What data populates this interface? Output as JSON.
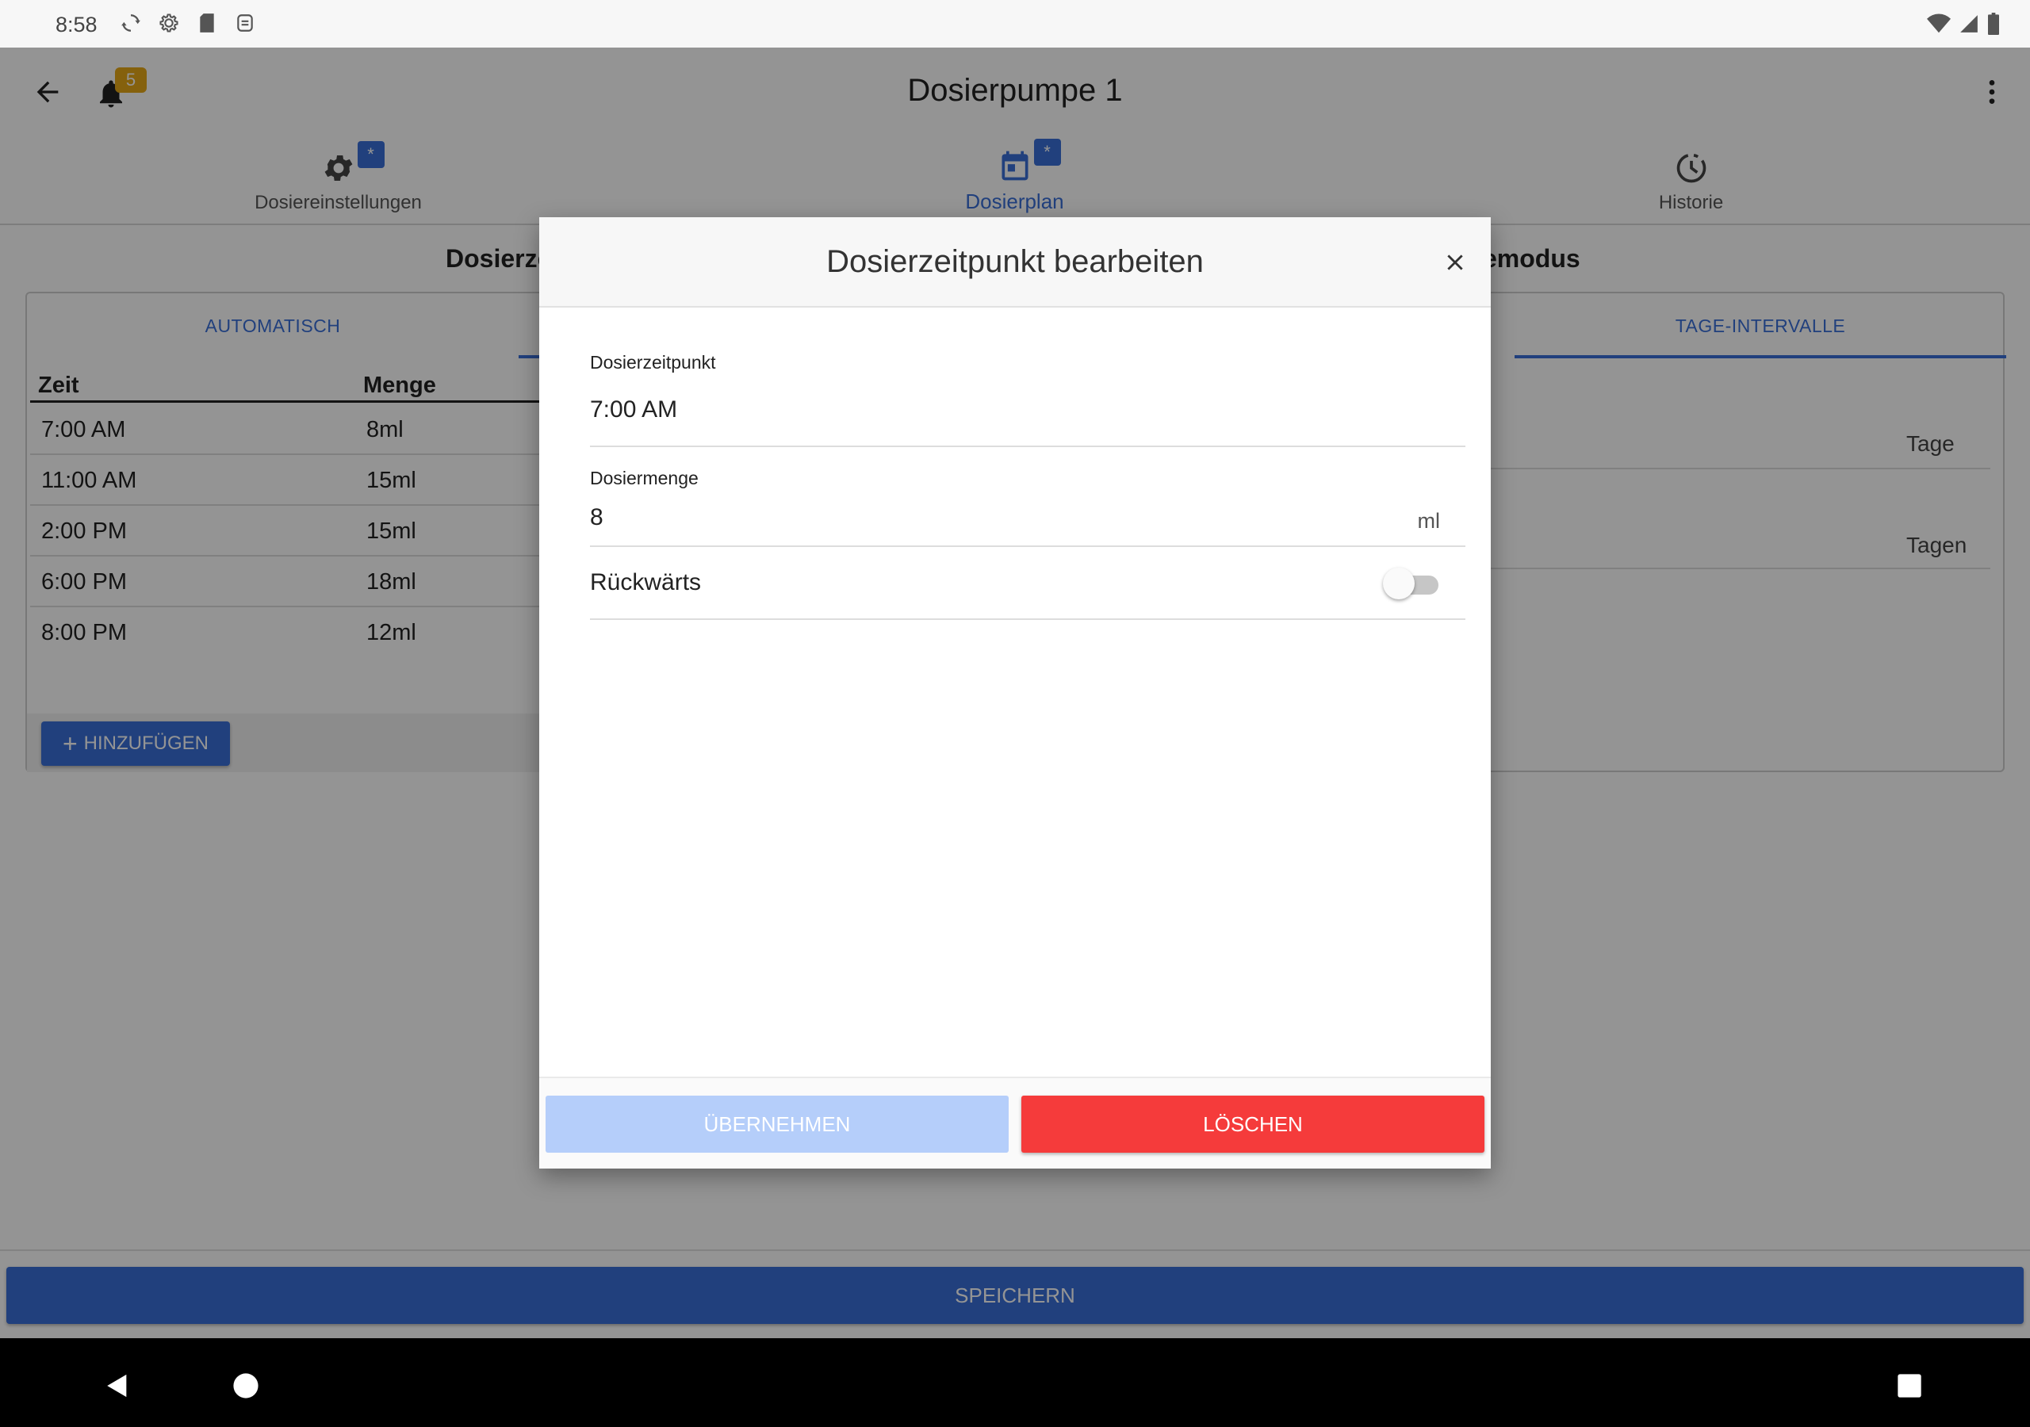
{
  "status_bar": {
    "time": "8:58",
    "left_icons": [
      "sync-icon",
      "gear-icon",
      "sd-card-icon",
      "storage-icon"
    ],
    "right_icons": [
      "wifi-icon",
      "signal-icon",
      "battery-icon"
    ]
  },
  "app_bar": {
    "title": "Dosierpumpe 1",
    "notification_count": "5"
  },
  "top_tabs": [
    {
      "label": "Dosiereinstellungen",
      "icon": "gear-icon",
      "badge": "*",
      "active": false
    },
    {
      "label": "Dosierplan",
      "icon": "calendar-icon",
      "badge": "*",
      "active": true
    },
    {
      "label": "Historie",
      "icon": "history-icon",
      "badge": "",
      "active": false
    }
  ],
  "main": {
    "left_section_title": "Dosierze",
    "right_section_title": "emodus",
    "sub_tabs": {
      "automatic": "AUTOMATISCH",
      "day_intervals": "TAGE-INTERVALLE"
    },
    "table": {
      "headers": [
        "Zeit",
        "Menge"
      ],
      "rows": [
        [
          "7:00 AM",
          "8ml"
        ],
        [
          "11:00 AM",
          "15ml"
        ],
        [
          "2:00 PM",
          "15ml"
        ],
        [
          "6:00 PM",
          "18ml"
        ],
        [
          "8:00 PM",
          "12ml"
        ]
      ]
    },
    "add_button": "HINZUFÜGEN",
    "right_labels": [
      "Tage",
      "Tagen"
    ]
  },
  "dialog": {
    "title": "Dosierzeitpunkt bearbeiten",
    "time_label": "Dosierzeitpunkt",
    "time_value": "7:00 AM",
    "amount_label": "Dosiermenge",
    "amount_value": "8",
    "amount_unit": "ml",
    "reverse_label": "Rückwärts",
    "reverse_on": false,
    "apply_button": "ÜBERNEHMEN",
    "delete_button": "LÖSCHEN"
  },
  "save_button": "SPEICHERN",
  "colors": {
    "accent": "#3a6fd8",
    "badge": "#e6a817",
    "delete": "#f53b3b",
    "apply_disabled": "#b5cefa"
  }
}
